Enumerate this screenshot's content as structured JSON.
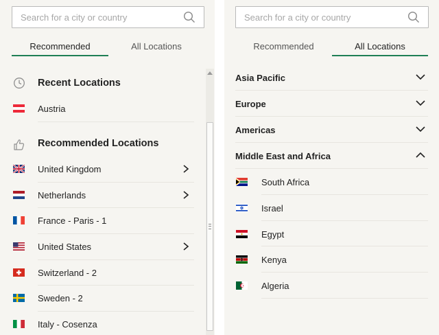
{
  "left_panel": {
    "search": {
      "placeholder": "Search for a city or country",
      "value": ""
    },
    "tabs": [
      {
        "label": "Recommended",
        "active": true
      },
      {
        "label": "All Locations",
        "active": false
      }
    ],
    "sections": [
      {
        "title": "Recent Locations",
        "icon": "clock-icon",
        "items": [
          {
            "label": "Austria",
            "flag": "austria-flag-icon",
            "expandable": false
          }
        ]
      },
      {
        "title": "Recommended Locations",
        "icon": "thumbs-up-icon",
        "items": [
          {
            "label": "United Kingdom",
            "flag": "united-kingdom-flag-icon",
            "expandable": true
          },
          {
            "label": "Netherlands",
            "flag": "netherlands-flag-icon",
            "expandable": true
          },
          {
            "label": "France - Paris - 1",
            "flag": "france-flag-icon",
            "expandable": false
          },
          {
            "label": "United States",
            "flag": "united-states-flag-icon",
            "expandable": true
          },
          {
            "label": "Switzerland - 2",
            "flag": "switzerland-flag-icon",
            "expandable": false
          },
          {
            "label": "Sweden - 2",
            "flag": "sweden-flag-icon",
            "expandable": false
          },
          {
            "label": "Italy - Cosenza",
            "flag": "italy-flag-icon",
            "expandable": false
          }
        ]
      }
    ]
  },
  "right_panel": {
    "search": {
      "placeholder": "Search for a city or country",
      "value": ""
    },
    "tabs": [
      {
        "label": "Recommended",
        "active": false
      },
      {
        "label": "All Locations",
        "active": true
      }
    ],
    "regions": [
      {
        "label": "Asia Pacific",
        "expanded": false
      },
      {
        "label": "Europe",
        "expanded": false
      },
      {
        "label": "Americas",
        "expanded": false
      },
      {
        "label": "Middle East and Africa",
        "expanded": true,
        "countries": [
          {
            "label": "South Africa",
            "flag": "south-africa-flag-icon"
          },
          {
            "label": "Israel",
            "flag": "israel-flag-icon"
          },
          {
            "label": "Egypt",
            "flag": "egypt-flag-icon"
          },
          {
            "label": "Kenya",
            "flag": "kenya-flag-icon"
          },
          {
            "label": "Algeria",
            "flag": "algeria-flag-icon"
          }
        ]
      }
    ]
  },
  "colors": {
    "accent": "#1e7f55",
    "panel_background": "#f6f5f1",
    "divider": "#e7e5df",
    "placeholder_text": "#a7a7a7"
  }
}
